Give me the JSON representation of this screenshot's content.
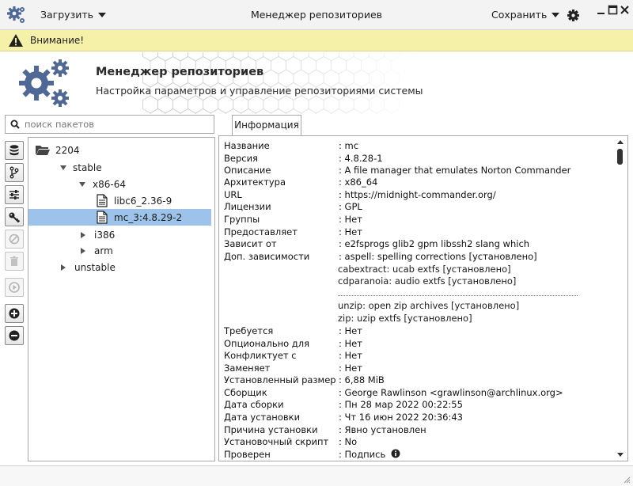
{
  "window": {
    "title": "Менеджер репозиториев",
    "load_label": "Загрузить",
    "save_label": "Сохранить"
  },
  "warning": {
    "text": "Внимание!"
  },
  "header": {
    "title": "Менеджер репозиториев",
    "subtitle": "Настройка параметров и управление репозиториями системы"
  },
  "search": {
    "placeholder": "поиск пакетов"
  },
  "tabs": [
    {
      "label": "Информация"
    }
  ],
  "tree": {
    "items": [
      {
        "label": "2204"
      },
      {
        "label": "stable"
      },
      {
        "label": "x86-64"
      },
      {
        "label": "libc6_2.36-9"
      },
      {
        "label": "mc_3:4.8.29-2"
      },
      {
        "label": "i386"
      },
      {
        "label": "arm"
      },
      {
        "label": "unstable"
      }
    ]
  },
  "info": {
    "rows": [
      {
        "key": "Название",
        "value": ": mc"
      },
      {
        "key": "Версия",
        "value": ": 4.8.28-1"
      },
      {
        "key": "Описание",
        "value": ": A file manager that emulates Norton Commander"
      },
      {
        "key": "Архитектура",
        "value": ": x86_64"
      },
      {
        "key": "URL",
        "value": ": https://midnight-commander.org/"
      },
      {
        "key": "Лицензии",
        "value": ": GPL"
      },
      {
        "key": "Группы",
        "value": ": Нет"
      },
      {
        "key": "Предоставляет",
        "value": ": Нет"
      },
      {
        "key": "Зависит от",
        "value": ": e2fsprogs  glib2  gpm  libssh2  slang  which"
      },
      {
        "key": "Доп. зависимости",
        "value": ": aspell: spelling corrections [установлено]"
      }
    ],
    "optdeps_more": [
      "cabextract: ucab extfs [установлено]",
      "cdparanoia: audio extfs [установлено]",
      "unzip: open zip archives [установлено]",
      "zip: uzip extfs [установлено]"
    ],
    "rows2": [
      {
        "key": "Требуется",
        "value": ": Нет"
      },
      {
        "key": "Опционально для",
        "value": ": Нет"
      },
      {
        "key": "Конфликтует с",
        "value": ": Нет"
      },
      {
        "key": "Заменяет",
        "value": ": Нет"
      },
      {
        "key": "Установленный размер",
        "value": ": 6,88 MiB"
      },
      {
        "key": "Сборщик",
        "value": ": George Rawlinson <grawlinson@archlinux.org>"
      },
      {
        "key": "Дата сборки",
        "value": ": Пн 28 мар 2022 00:22:55"
      },
      {
        "key": "Дата установки",
        "value": ": Чт 16 июн 2022 20:36:43"
      },
      {
        "key": "Причина установки",
        "value": ": Явно установлен"
      },
      {
        "key": "Установочный скрипт",
        "value": ": No"
      },
      {
        "key": "Проверен",
        "value": ": Подпись"
      }
    ]
  },
  "colors": {
    "warning_bg": "#f6f1a9",
    "selection": "#9ec3ea",
    "gear": "#4f6896"
  }
}
